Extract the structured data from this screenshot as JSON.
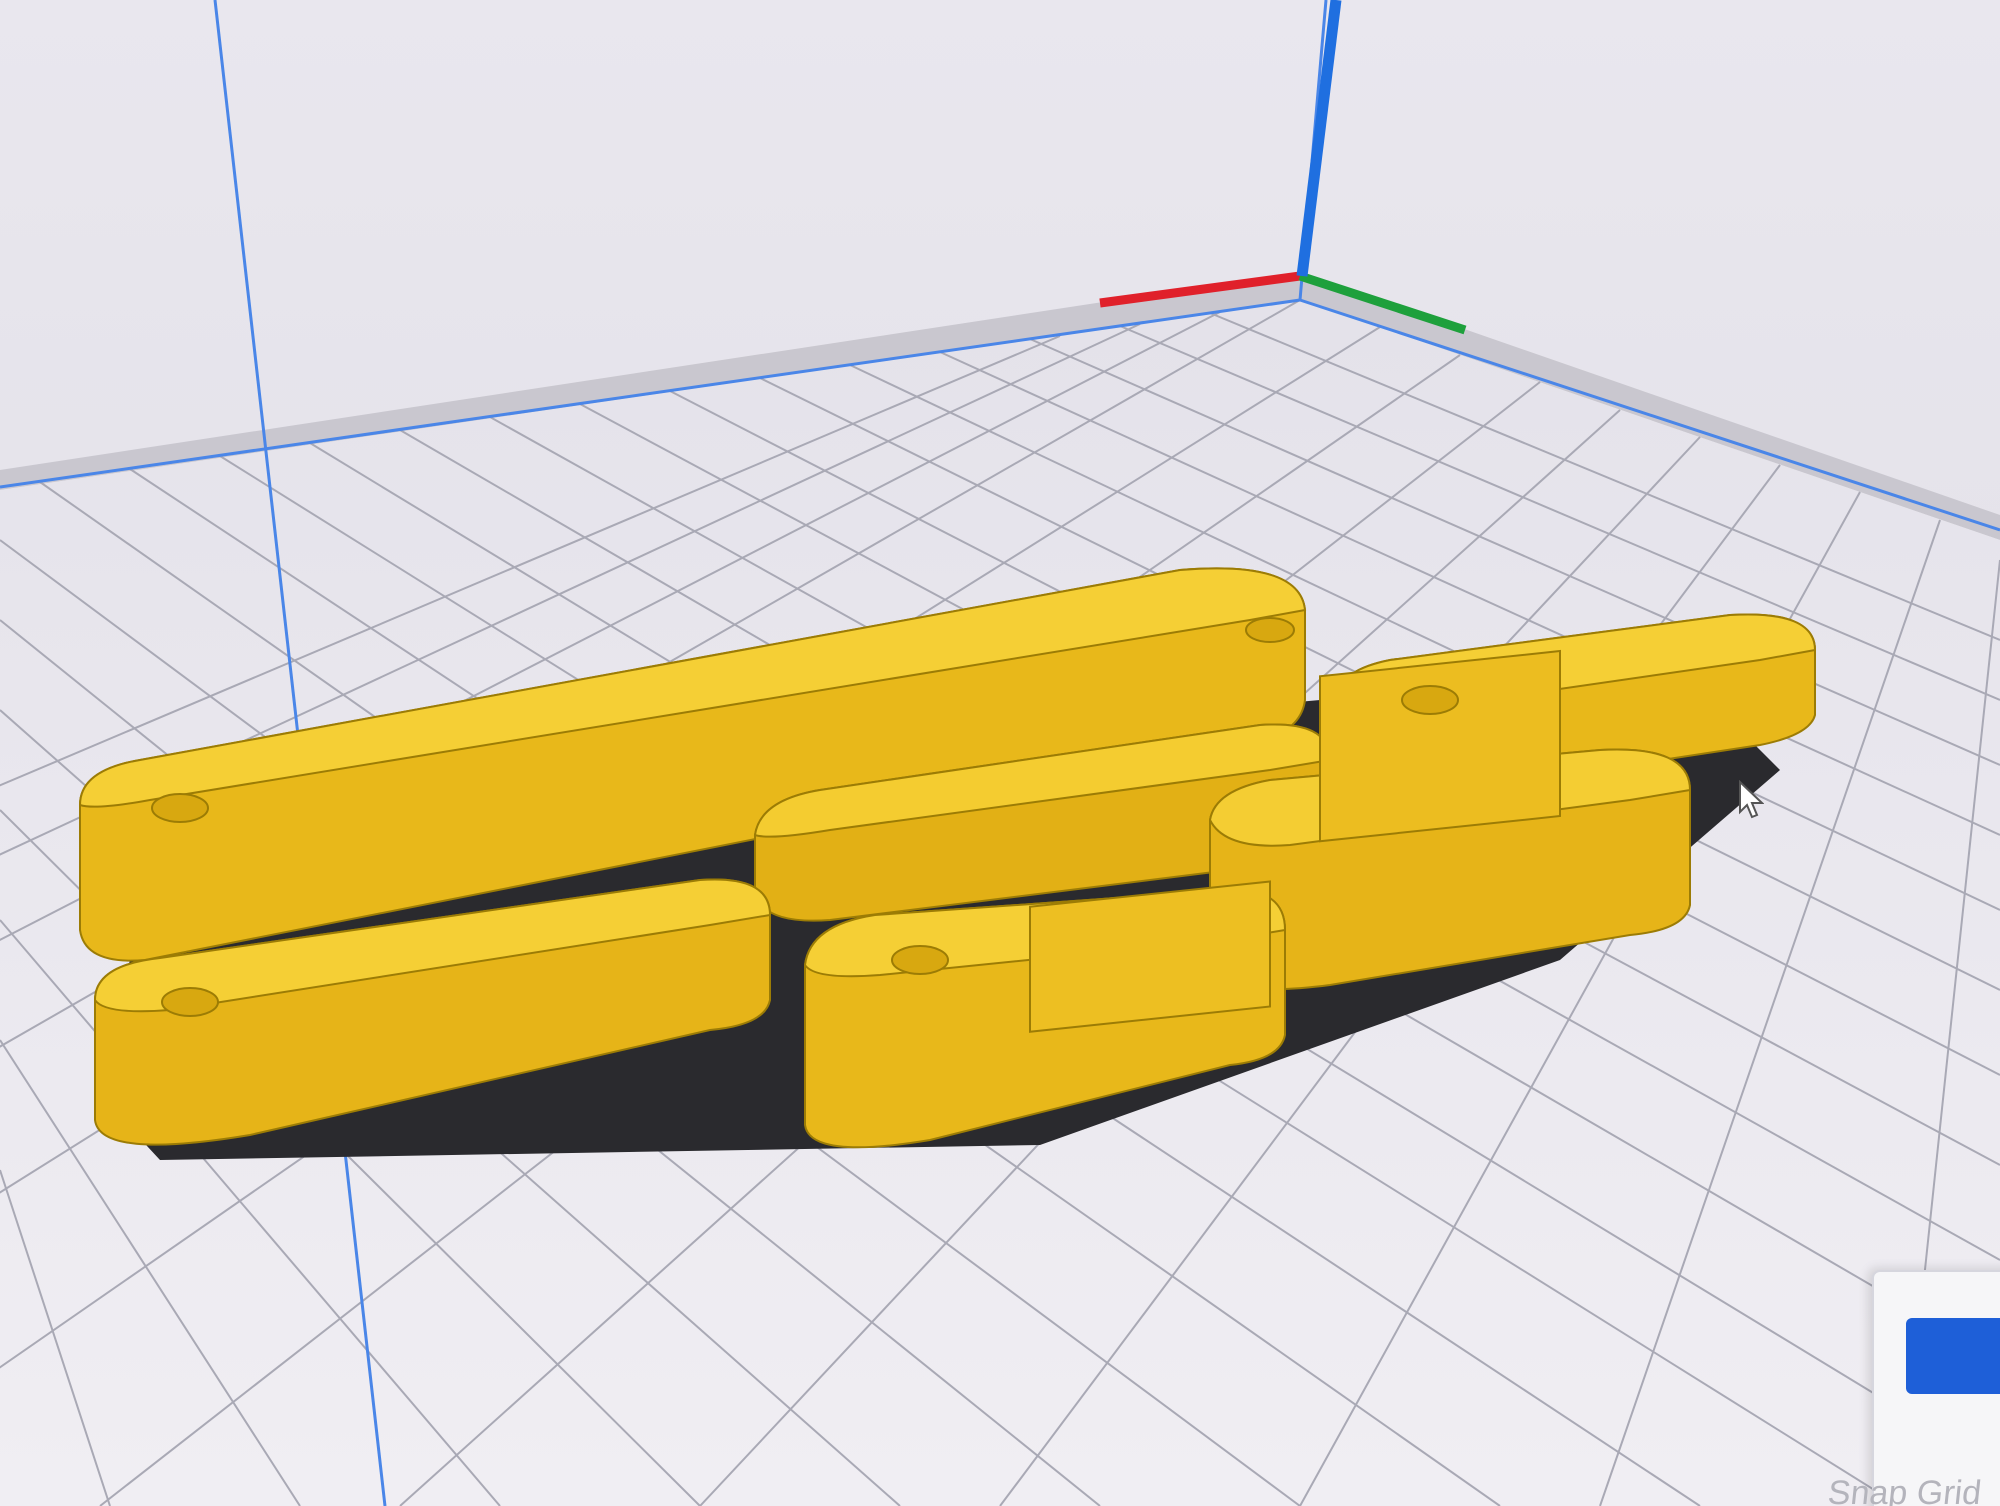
{
  "viewport": {
    "model_color": "#f2c21a",
    "model_shadow_color": "#c99e08",
    "build_plate_color": "#eceaf0",
    "grid_line_color": "#a8a8b4",
    "axis_x_color": "#e0202a",
    "axis_y_color": "#1ea03c",
    "axis_z_color": "#1f6fe0",
    "volume_edge_color": "#4a86e8",
    "icons": [
      "cursor-arrow-icon"
    ]
  },
  "side_panel": {
    "primary_button_color": "#1e5fd8",
    "checkbox_label": "Snap Grid"
  }
}
